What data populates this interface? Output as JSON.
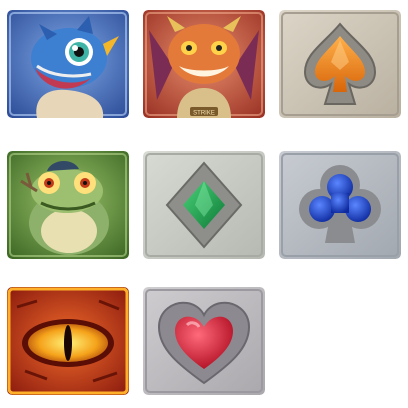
{
  "symbols": [
    {
      "id": "blue-dragon",
      "icon": "blue-baby-dragon-icon",
      "frame_color": "#4a73b8"
    },
    {
      "id": "orange-dragon",
      "icon": "orange-dragon-icon",
      "frame_color": "#c0533a",
      "badge_text": "STRIKE"
    },
    {
      "id": "spade",
      "icon": "spade-icon",
      "frame_color": "#cfc7b8",
      "gem_color": "#f08a18"
    },
    {
      "id": "frog",
      "icon": "frog-creature-icon",
      "frame_color": "#5d8a3a"
    },
    {
      "id": "diamond",
      "icon": "diamond-icon",
      "frame_color": "#c8cac4",
      "gem_color": "#16a04a"
    },
    {
      "id": "club",
      "icon": "club-icon",
      "frame_color": "#b7bcc4",
      "gem_color": "#1a3fc8"
    },
    {
      "id": "dragon-eye",
      "icon": "dragon-eye-icon",
      "frame_color": "#d8381a"
    },
    {
      "id": "heart",
      "icon": "heart-icon",
      "frame_color": "#c0bfc2",
      "gem_color": "#e0203a"
    }
  ]
}
